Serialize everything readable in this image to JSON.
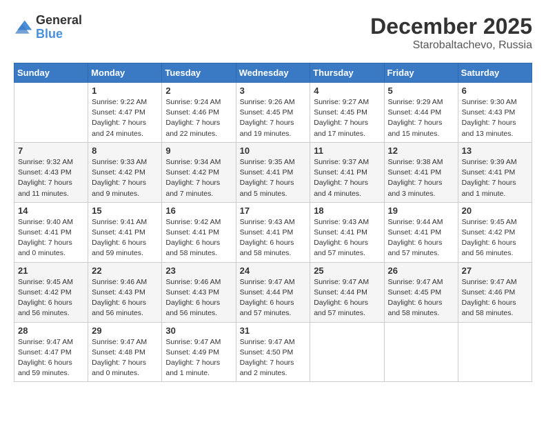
{
  "logo": {
    "general": "General",
    "blue": "Blue"
  },
  "title": {
    "month": "December 2025",
    "location": "Starobaltachevo, Russia"
  },
  "headers": [
    "Sunday",
    "Monday",
    "Tuesday",
    "Wednesday",
    "Thursday",
    "Friday",
    "Saturday"
  ],
  "weeks": [
    [
      {
        "day": "",
        "sunrise": "",
        "sunset": "",
        "daylight": ""
      },
      {
        "day": "1",
        "sunrise": "Sunrise: 9:22 AM",
        "sunset": "Sunset: 4:47 PM",
        "daylight": "Daylight: 7 hours and 24 minutes."
      },
      {
        "day": "2",
        "sunrise": "Sunrise: 9:24 AM",
        "sunset": "Sunset: 4:46 PM",
        "daylight": "Daylight: 7 hours and 22 minutes."
      },
      {
        "day": "3",
        "sunrise": "Sunrise: 9:26 AM",
        "sunset": "Sunset: 4:45 PM",
        "daylight": "Daylight: 7 hours and 19 minutes."
      },
      {
        "day": "4",
        "sunrise": "Sunrise: 9:27 AM",
        "sunset": "Sunset: 4:45 PM",
        "daylight": "Daylight: 7 hours and 17 minutes."
      },
      {
        "day": "5",
        "sunrise": "Sunrise: 9:29 AM",
        "sunset": "Sunset: 4:44 PM",
        "daylight": "Daylight: 7 hours and 15 minutes."
      },
      {
        "day": "6",
        "sunrise": "Sunrise: 9:30 AM",
        "sunset": "Sunset: 4:43 PM",
        "daylight": "Daylight: 7 hours and 13 minutes."
      }
    ],
    [
      {
        "day": "7",
        "sunrise": "Sunrise: 9:32 AM",
        "sunset": "Sunset: 4:43 PM",
        "daylight": "Daylight: 7 hours and 11 minutes."
      },
      {
        "day": "8",
        "sunrise": "Sunrise: 9:33 AM",
        "sunset": "Sunset: 4:42 PM",
        "daylight": "Daylight: 7 hours and 9 minutes."
      },
      {
        "day": "9",
        "sunrise": "Sunrise: 9:34 AM",
        "sunset": "Sunset: 4:42 PM",
        "daylight": "Daylight: 7 hours and 7 minutes."
      },
      {
        "day": "10",
        "sunrise": "Sunrise: 9:35 AM",
        "sunset": "Sunset: 4:41 PM",
        "daylight": "Daylight: 7 hours and 5 minutes."
      },
      {
        "day": "11",
        "sunrise": "Sunrise: 9:37 AM",
        "sunset": "Sunset: 4:41 PM",
        "daylight": "Daylight: 7 hours and 4 minutes."
      },
      {
        "day": "12",
        "sunrise": "Sunrise: 9:38 AM",
        "sunset": "Sunset: 4:41 PM",
        "daylight": "Daylight: 7 hours and 3 minutes."
      },
      {
        "day": "13",
        "sunrise": "Sunrise: 9:39 AM",
        "sunset": "Sunset: 4:41 PM",
        "daylight": "Daylight: 7 hours and 1 minute."
      }
    ],
    [
      {
        "day": "14",
        "sunrise": "Sunrise: 9:40 AM",
        "sunset": "Sunset: 4:41 PM",
        "daylight": "Daylight: 7 hours and 0 minutes."
      },
      {
        "day": "15",
        "sunrise": "Sunrise: 9:41 AM",
        "sunset": "Sunset: 4:41 PM",
        "daylight": "Daylight: 6 hours and 59 minutes."
      },
      {
        "day": "16",
        "sunrise": "Sunrise: 9:42 AM",
        "sunset": "Sunset: 4:41 PM",
        "daylight": "Daylight: 6 hours and 58 minutes."
      },
      {
        "day": "17",
        "sunrise": "Sunrise: 9:43 AM",
        "sunset": "Sunset: 4:41 PM",
        "daylight": "Daylight: 6 hours and 58 minutes."
      },
      {
        "day": "18",
        "sunrise": "Sunrise: 9:43 AM",
        "sunset": "Sunset: 4:41 PM",
        "daylight": "Daylight: 6 hours and 57 minutes."
      },
      {
        "day": "19",
        "sunrise": "Sunrise: 9:44 AM",
        "sunset": "Sunset: 4:41 PM",
        "daylight": "Daylight: 6 hours and 57 minutes."
      },
      {
        "day": "20",
        "sunrise": "Sunrise: 9:45 AM",
        "sunset": "Sunset: 4:42 PM",
        "daylight": "Daylight: 6 hours and 56 minutes."
      }
    ],
    [
      {
        "day": "21",
        "sunrise": "Sunrise: 9:45 AM",
        "sunset": "Sunset: 4:42 PM",
        "daylight": "Daylight: 6 hours and 56 minutes."
      },
      {
        "day": "22",
        "sunrise": "Sunrise: 9:46 AM",
        "sunset": "Sunset: 4:43 PM",
        "daylight": "Daylight: 6 hours and 56 minutes."
      },
      {
        "day": "23",
        "sunrise": "Sunrise: 9:46 AM",
        "sunset": "Sunset: 4:43 PM",
        "daylight": "Daylight: 6 hours and 56 minutes."
      },
      {
        "day": "24",
        "sunrise": "Sunrise: 9:47 AM",
        "sunset": "Sunset: 4:44 PM",
        "daylight": "Daylight: 6 hours and 57 minutes."
      },
      {
        "day": "25",
        "sunrise": "Sunrise: 9:47 AM",
        "sunset": "Sunset: 4:44 PM",
        "daylight": "Daylight: 6 hours and 57 minutes."
      },
      {
        "day": "26",
        "sunrise": "Sunrise: 9:47 AM",
        "sunset": "Sunset: 4:45 PM",
        "daylight": "Daylight: 6 hours and 58 minutes."
      },
      {
        "day": "27",
        "sunrise": "Sunrise: 9:47 AM",
        "sunset": "Sunset: 4:46 PM",
        "daylight": "Daylight: 6 hours and 58 minutes."
      }
    ],
    [
      {
        "day": "28",
        "sunrise": "Sunrise: 9:47 AM",
        "sunset": "Sunset: 4:47 PM",
        "daylight": "Daylight: 6 hours and 59 minutes."
      },
      {
        "day": "29",
        "sunrise": "Sunrise: 9:47 AM",
        "sunset": "Sunset: 4:48 PM",
        "daylight": "Daylight: 7 hours and 0 minutes."
      },
      {
        "day": "30",
        "sunrise": "Sunrise: 9:47 AM",
        "sunset": "Sunset: 4:49 PM",
        "daylight": "Daylight: 7 hours and 1 minute."
      },
      {
        "day": "31",
        "sunrise": "Sunrise: 9:47 AM",
        "sunset": "Sunset: 4:50 PM",
        "daylight": "Daylight: 7 hours and 2 minutes."
      },
      {
        "day": "",
        "sunrise": "",
        "sunset": "",
        "daylight": ""
      },
      {
        "day": "",
        "sunrise": "",
        "sunset": "",
        "daylight": ""
      },
      {
        "day": "",
        "sunrise": "",
        "sunset": "",
        "daylight": ""
      }
    ]
  ]
}
